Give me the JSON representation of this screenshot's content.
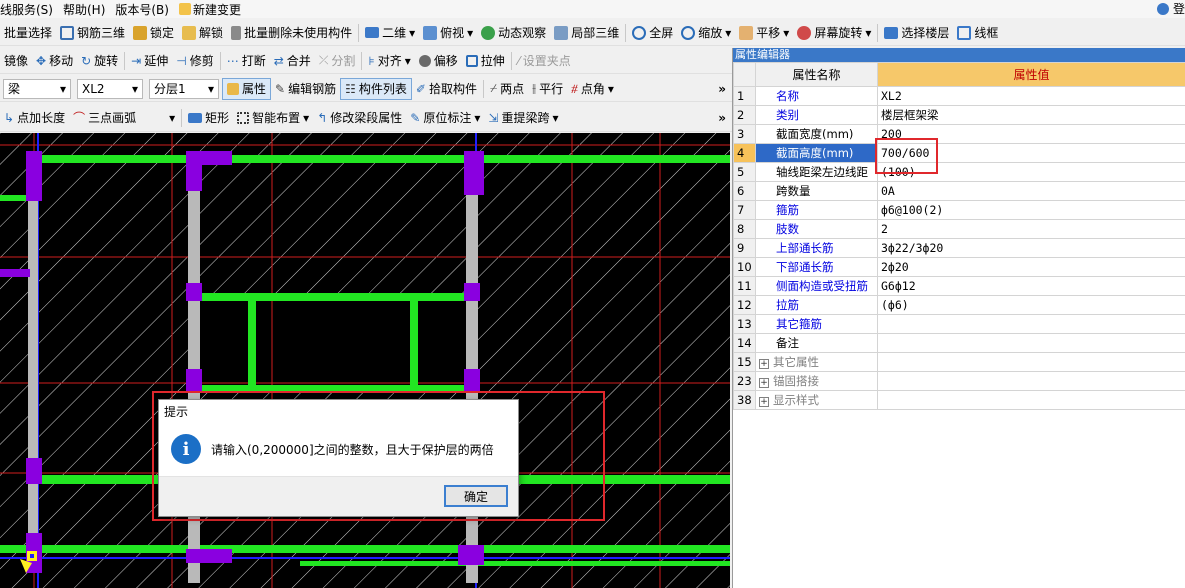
{
  "menu": {
    "items": [
      "线服务(S)",
      "帮助(H)",
      "版本号(B)",
      "新建变更"
    ],
    "right_label": "登"
  },
  "toolbar1": {
    "items": [
      "批量选择",
      "钢筋三维",
      "锁定",
      "解锁",
      "批量删除未使用构件",
      "二维",
      "俯视",
      "动态观察",
      "局部三维",
      "全屏",
      "缩放",
      "平移",
      "屏幕旋转",
      "选择楼层",
      "线框"
    ]
  },
  "toolbar2": {
    "items": [
      "镜像",
      "移动",
      "旋转",
      "延伸",
      "修剪",
      "打断",
      "合并",
      "分割",
      "对齐",
      "偏移",
      "拉伸",
      "设置夹点"
    ],
    "more": "»"
  },
  "toolbar3": {
    "type_value": "梁",
    "component_value": "XL2",
    "layer_value": "分层1",
    "items": [
      "属性",
      "编辑钢筋",
      "构件列表",
      "拾取构件",
      "两点",
      "平行",
      "点角"
    ],
    "more": "»"
  },
  "toolbar4": {
    "items": [
      "点加长度",
      "三点画弧",
      "矩形",
      "智能布置",
      "修改梁段属性",
      "原位标注",
      "重提梁跨"
    ],
    "more": "»"
  },
  "dialog": {
    "title": "提示",
    "icon": "i",
    "message": "请输入(0,200000]之间的整数，且大于保护层的两倍",
    "ok_label": "确定"
  },
  "property_panel": {
    "title": "属性编辑器",
    "col_name": "属性名称",
    "col_value": "属性值",
    "rows": [
      {
        "num": "1",
        "name": "名称",
        "value": "XL2",
        "style": "blue"
      },
      {
        "num": "2",
        "name": "类别",
        "value": "楼层框架梁",
        "style": "blue"
      },
      {
        "num": "3",
        "name": "截面宽度(mm)",
        "value": "200",
        "style": "black"
      },
      {
        "num": "4",
        "name": "截面高度(mm)",
        "value": "700/600",
        "style": "selected"
      },
      {
        "num": "5",
        "name": "轴线距梁左边线距",
        "value": "(100)",
        "style": "black"
      },
      {
        "num": "6",
        "name": "跨数量",
        "value": "0A",
        "style": "black"
      },
      {
        "num": "7",
        "name": "箍筋",
        "value": "ф6@100(2)",
        "style": "blue"
      },
      {
        "num": "8",
        "name": "肢数",
        "value": "2",
        "style": "blue"
      },
      {
        "num": "9",
        "name": "上部通长筋",
        "value": "3ф22/3ф20",
        "style": "blue"
      },
      {
        "num": "10",
        "name": "下部通长筋",
        "value": "2ф20",
        "style": "blue"
      },
      {
        "num": "11",
        "name": "侧面构造或受扭筋",
        "value": "G6ф12",
        "style": "blue"
      },
      {
        "num": "12",
        "name": "拉筋",
        "value": "(ф6)",
        "style": "blue"
      },
      {
        "num": "13",
        "name": "其它箍筋",
        "value": "",
        "style": "blue"
      },
      {
        "num": "14",
        "name": "备注",
        "value": "",
        "style": "black"
      },
      {
        "num": "15",
        "name": "其它属性",
        "value": "",
        "style": "group"
      },
      {
        "num": "23",
        "name": "锚固搭接",
        "value": "",
        "style": "group"
      },
      {
        "num": "38",
        "name": "显示样式",
        "value": "",
        "style": "group"
      }
    ]
  },
  "colors": {
    "beam": "#22e622",
    "column": "#8a00e0",
    "axis_red": "#d01e1e",
    "axis_blue": "#2020ff",
    "highlight": "#e0282c"
  }
}
